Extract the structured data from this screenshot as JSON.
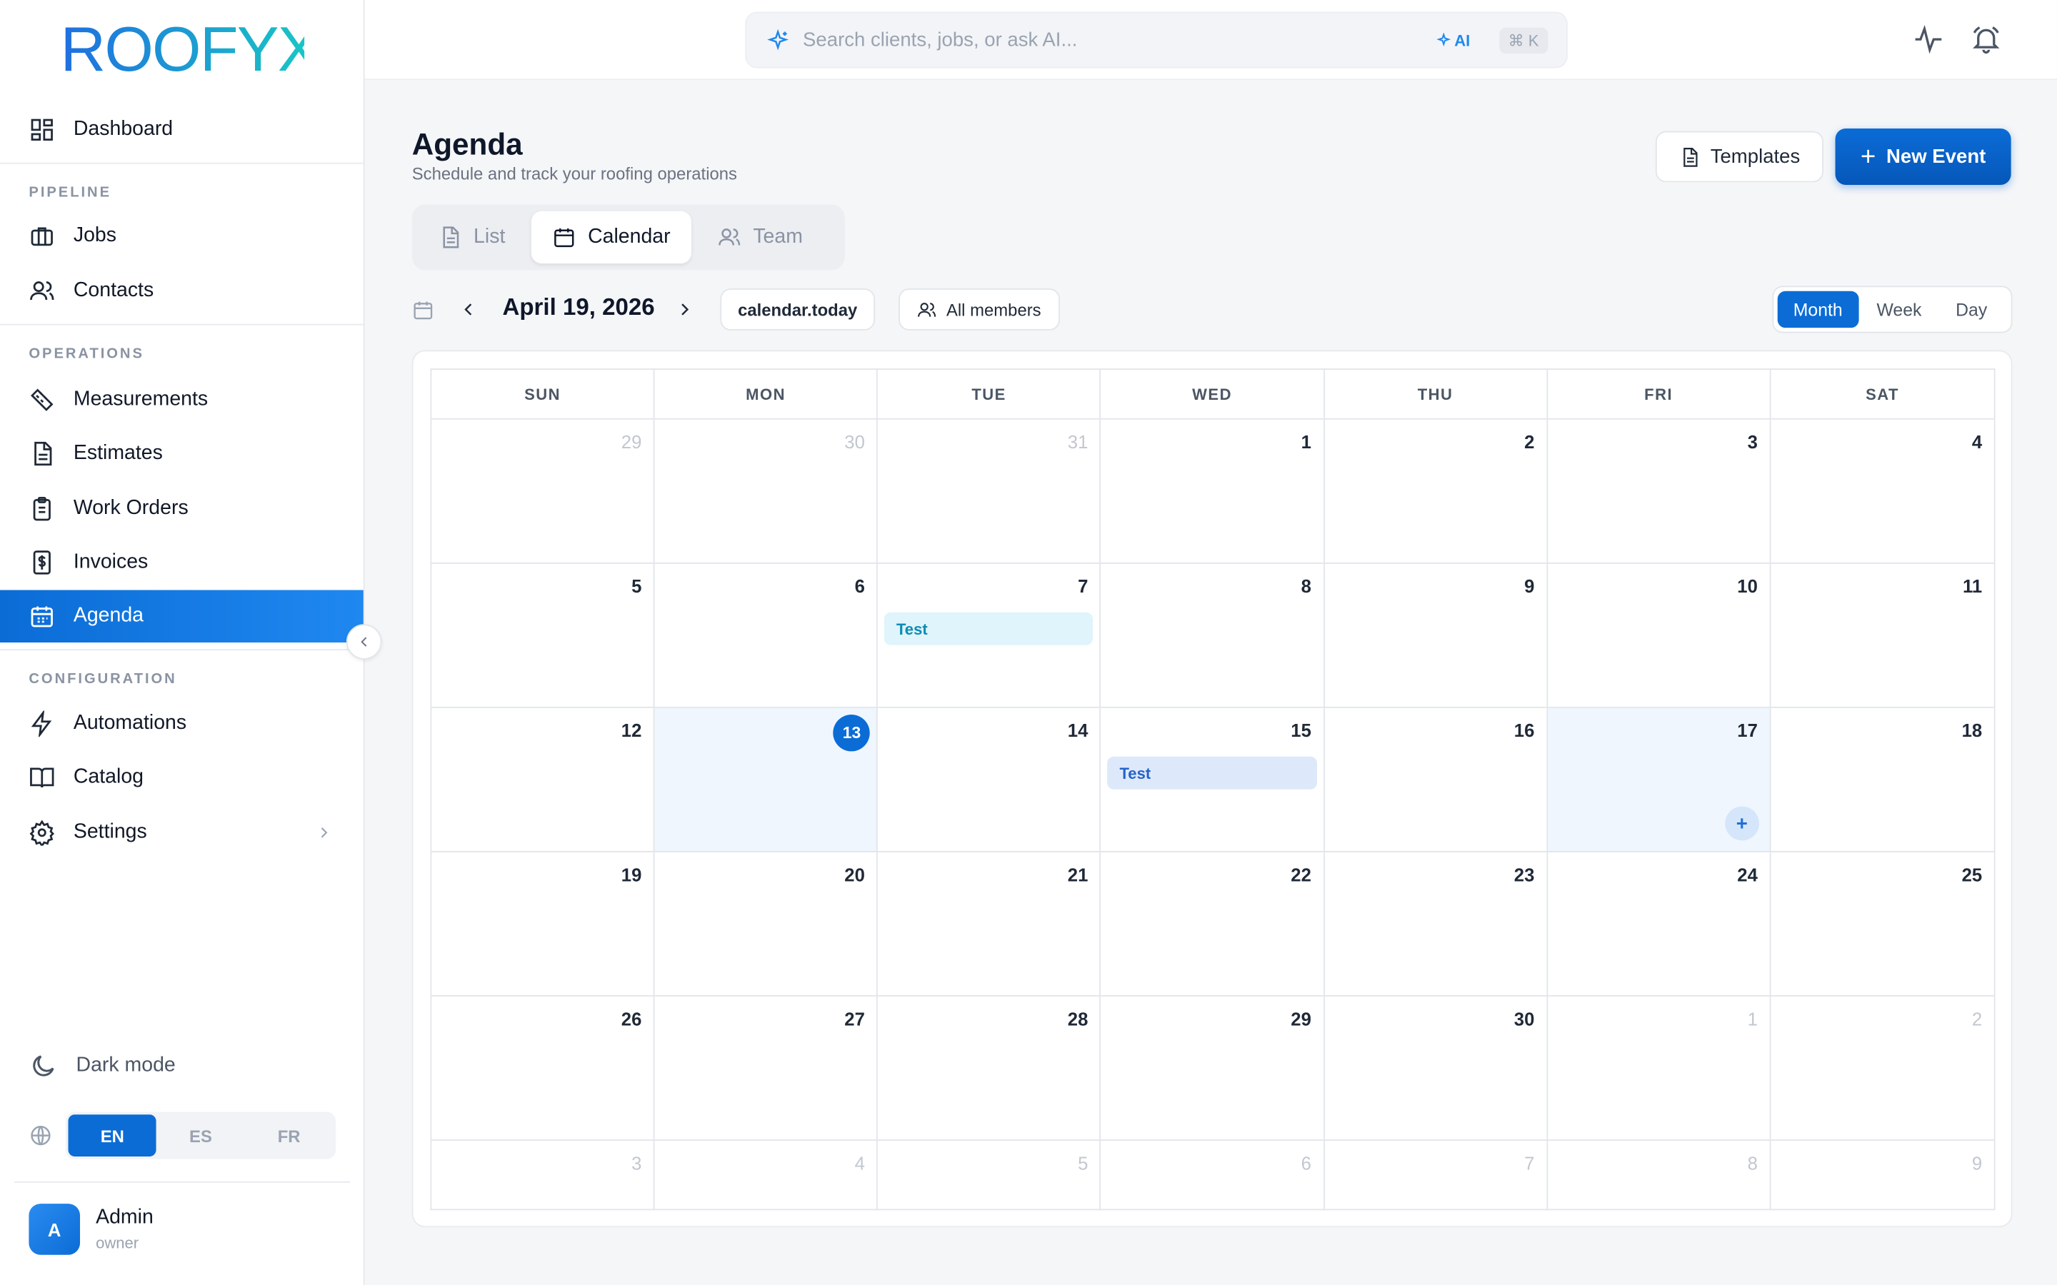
{
  "brand": {
    "logo_text": "ROOFYX"
  },
  "sidebar": {
    "items_top": [
      {
        "label": "Dashboard",
        "icon": "dashboard-icon"
      }
    ],
    "sections": [
      {
        "label": "PIPELINE",
        "items": [
          {
            "label": "Jobs",
            "icon": "briefcase-icon"
          },
          {
            "label": "Contacts",
            "icon": "users-icon"
          }
        ]
      },
      {
        "label": "OPERATIONS",
        "items": [
          {
            "label": "Measurements",
            "icon": "ruler-icon"
          },
          {
            "label": "Estimates",
            "icon": "document-icon"
          },
          {
            "label": "Work Orders",
            "icon": "clipboard-icon"
          },
          {
            "label": "Invoices",
            "icon": "dollar-receipt-icon"
          },
          {
            "label": "Agenda",
            "icon": "calendar-icon",
            "active": true
          }
        ]
      },
      {
        "label": "CONFIGURATION",
        "items": [
          {
            "label": "Automations",
            "icon": "lightning-icon"
          },
          {
            "label": "Catalog",
            "icon": "book-icon"
          },
          {
            "label": "Settings",
            "icon": "gear-icon"
          }
        ]
      }
    ],
    "dark_mode_label": "Dark mode",
    "languages": [
      "EN",
      "ES",
      "FR"
    ],
    "active_language": "EN",
    "user": {
      "initial": "A",
      "name": "Admin",
      "role": "owner"
    }
  },
  "topbar": {
    "search_placeholder": "Search clients, jobs, or ask AI...",
    "ai_tag": "AI",
    "shortcut": "⌘ K"
  },
  "page": {
    "title": "Agenda",
    "subtitle": "Schedule and track your roofing operations",
    "templates_label": "Templates",
    "new_event_label": "New Event",
    "view_tabs": [
      "List",
      "Calendar",
      "Team"
    ],
    "active_view": "Calendar"
  },
  "calendar": {
    "current_date": "April 19, 2026",
    "today_label": "calendar.today",
    "members_label": "All members",
    "modes": [
      "Month",
      "Week",
      "Day"
    ],
    "active_mode": "Month",
    "weekdays": [
      "SUN",
      "MON",
      "TUE",
      "WED",
      "THU",
      "FRI",
      "SAT"
    ],
    "weeks": [
      [
        {
          "d": "29",
          "other": true
        },
        {
          "d": "30",
          "other": true
        },
        {
          "d": "31",
          "other": true
        },
        {
          "d": "1"
        },
        {
          "d": "2"
        },
        {
          "d": "3"
        },
        {
          "d": "4"
        }
      ],
      [
        {
          "d": "5"
        },
        {
          "d": "6"
        },
        {
          "d": "7",
          "event": "Test",
          "event_color": "teal"
        },
        {
          "d": "8"
        },
        {
          "d": "9"
        },
        {
          "d": "10"
        },
        {
          "d": "11"
        }
      ],
      [
        {
          "d": "12"
        },
        {
          "d": "13",
          "today": true,
          "highlight": true
        },
        {
          "d": "14"
        },
        {
          "d": "15",
          "event": "Test",
          "event_color": "blue"
        },
        {
          "d": "16"
        },
        {
          "d": "17",
          "highlight": true,
          "add": true
        },
        {
          "d": "18"
        }
      ],
      [
        {
          "d": "19"
        },
        {
          "d": "20"
        },
        {
          "d": "21"
        },
        {
          "d": "22"
        },
        {
          "d": "23"
        },
        {
          "d": "24"
        },
        {
          "d": "25"
        }
      ],
      [
        {
          "d": "26"
        },
        {
          "d": "27"
        },
        {
          "d": "28"
        },
        {
          "d": "29"
        },
        {
          "d": "30"
        },
        {
          "d": "1",
          "other": true
        },
        {
          "d": "2",
          "other": true
        }
      ],
      [
        {
          "d": "3",
          "other": true
        },
        {
          "d": "4",
          "other": true
        },
        {
          "d": "5",
          "other": true
        },
        {
          "d": "6",
          "other": true
        },
        {
          "d": "7",
          "other": true
        },
        {
          "d": "8",
          "other": true
        },
        {
          "d": "9",
          "other": true
        }
      ]
    ]
  },
  "colors": {
    "accent": "#0b6cd6",
    "logo": "#12b3c9",
    "today": "#0b6cd6"
  }
}
